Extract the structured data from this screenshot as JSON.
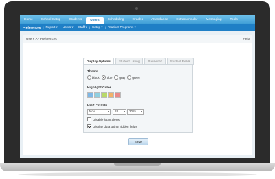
{
  "nav": {
    "items": [
      {
        "label": "Home"
      },
      {
        "label": "School Setup"
      },
      {
        "label": "Students"
      },
      {
        "label": "Users"
      },
      {
        "label": "Scheduling"
      },
      {
        "label": "Grades"
      },
      {
        "label": "Attendance"
      },
      {
        "label": "Extracurricular"
      },
      {
        "label": "Messaging"
      },
      {
        "label": "Tools"
      }
    ],
    "active": "Users"
  },
  "subnav": {
    "items": [
      {
        "label": "Preferences"
      },
      {
        "label": "Report ▾"
      },
      {
        "label": "Users ▾"
      },
      {
        "label": "Staff ▾"
      },
      {
        "label": "Setup ▾"
      },
      {
        "label": "Teacher Programs ▾"
      }
    ],
    "separator": "|"
  },
  "breadcrumb": "Users >> Preferences",
  "help_label": "Help",
  "tabs": [
    {
      "label": "Display Options"
    },
    {
      "label": "Student Listing"
    },
    {
      "label": "Password"
    },
    {
      "label": "Student Fields"
    }
  ],
  "theme": {
    "label": "Theme",
    "options": [
      {
        "label": "black"
      },
      {
        "label": "blue"
      },
      {
        "label": "gray"
      },
      {
        "label": "green"
      }
    ],
    "selected": "blue"
  },
  "highlight": {
    "label": "Highlight Color",
    "swatches": [
      {
        "color": "#7fb8e6",
        "icon": "color-swatch-icon"
      },
      {
        "color": "#8fcfe0",
        "icon": "color-swatch-icon"
      },
      {
        "color": "#b8d96a",
        "icon": "color-swatch-icon"
      },
      {
        "color": "#f2b26a",
        "icon": "color-swatch-icon"
      },
      {
        "color": "#e98a8a",
        "icon": "color-swatch-icon"
      }
    ]
  },
  "date_format": {
    "label": "Date Format",
    "month": "Nov",
    "day": "19",
    "year": "2015"
  },
  "options": {
    "disable_login_alerts": {
      "label": "Disable login alerts",
      "checked": false
    },
    "display_hidden_fields": {
      "label": "Display data using hidden fields",
      "checked": true
    }
  },
  "save_label": "Save"
}
